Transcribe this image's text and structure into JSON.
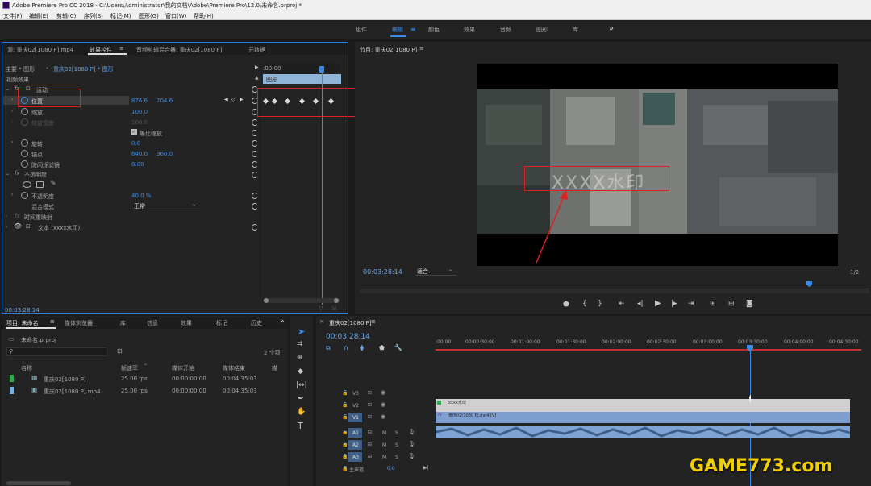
{
  "window": {
    "title": "Adobe Premiere Pro CC 2018 - C:\\Users\\Administrator\\我的文档\\Adobe\\Premiere Pro\\12.0\\未命名.prproj *"
  },
  "menu": [
    "文件(F)",
    "编辑(E)",
    "剪辑(C)",
    "序列(S)",
    "标记(M)",
    "图形(G)",
    "窗口(W)",
    "帮助(H)"
  ],
  "workspaces": [
    "组件",
    "编辑",
    "颜色",
    "效果",
    "音频",
    "图形",
    "库"
  ],
  "workspaces_more": "»",
  "source_tabs": {
    "source": "源: 重庆02[1080 P].mp4",
    "effect_controls": "效果控件",
    "audio_mixer": "音频剪辑混合器: 重庆02[1080 P]",
    "metadata": "元数据"
  },
  "effect_controls": {
    "master": "主要 * 图形",
    "clip": "重庆02[1080 P] * 图形",
    "time_start": ":00:00",
    "graphic_label": "图形",
    "video_effects": "视频效果",
    "motion": "运动",
    "position": "位置",
    "position_x": "876.6",
    "position_y": "704.6",
    "scale": "缩放",
    "scale_val": "100.0",
    "scale_width": "缩放宽度",
    "scale_width_val": "100.0",
    "uniform_scale": "等比缩放",
    "rotation": "旋转",
    "rotation_val": "0.0",
    "anchor": "锚点",
    "anchor_x": "640.0",
    "anchor_y": "360.0",
    "anti_flicker": "防闪烁滤镜",
    "anti_flicker_val": "0.00",
    "opacity_group": "不透明度",
    "opacity": "不透明度",
    "opacity_val": "40.0 %",
    "blend": "混合模式",
    "blend_val": "正常",
    "time_remap": "时间重映射",
    "text_layer": "文本 (xxxx水印)",
    "timecode": "00:03:28:14"
  },
  "program": {
    "title": "节目: 重庆02[1080 P]",
    "timecode": "00:03:28:14",
    "fit": "适合",
    "fraction": "1/2",
    "watermark": "XXXX水印"
  },
  "project": {
    "tabs": [
      "项目: 未命名",
      "媒体浏览器",
      "库",
      "信息",
      "效果",
      "标记",
      "历史"
    ],
    "file": "未命名.prproj",
    "count": "2 个项",
    "columns": [
      "名称",
      "帧速率",
      "媒体开始",
      "媒体结束",
      "媒"
    ],
    "rows": [
      {
        "name": "重庆02[1080 P]",
        "fps": "25.00 fps",
        "start": "00:00:00:00",
        "end": "00:04:35:03",
        "color": "#2fa84f"
      },
      {
        "name": "重庆02[1080 P].mp4",
        "fps": "25.00 fps",
        "start": "00:00:00:00",
        "end": "00:04:35:03",
        "color": "#7ab0e0"
      }
    ]
  },
  "timeline": {
    "tab": "重庆02[1080 P]",
    "timecode": "00:03:28:14",
    "ruler": [
      ":00:00",
      "00:00:30:00",
      "00:01:00:00",
      "00:01:30:00",
      "00:02:00:00",
      "00:02:30:00",
      "00:03:00:00",
      "00:03:30:00",
      "00:04:00:00",
      "00:04:30:00"
    ],
    "tracks": [
      "V3",
      "V2",
      "V1",
      "A1",
      "A2",
      "A3"
    ],
    "master": "主声道",
    "master_val": "0.0",
    "clip_text": "xxxx水印",
    "clip_video": "重庆02[1080 P].mp4 [V]"
  },
  "watermark_site": "GAME773.com"
}
